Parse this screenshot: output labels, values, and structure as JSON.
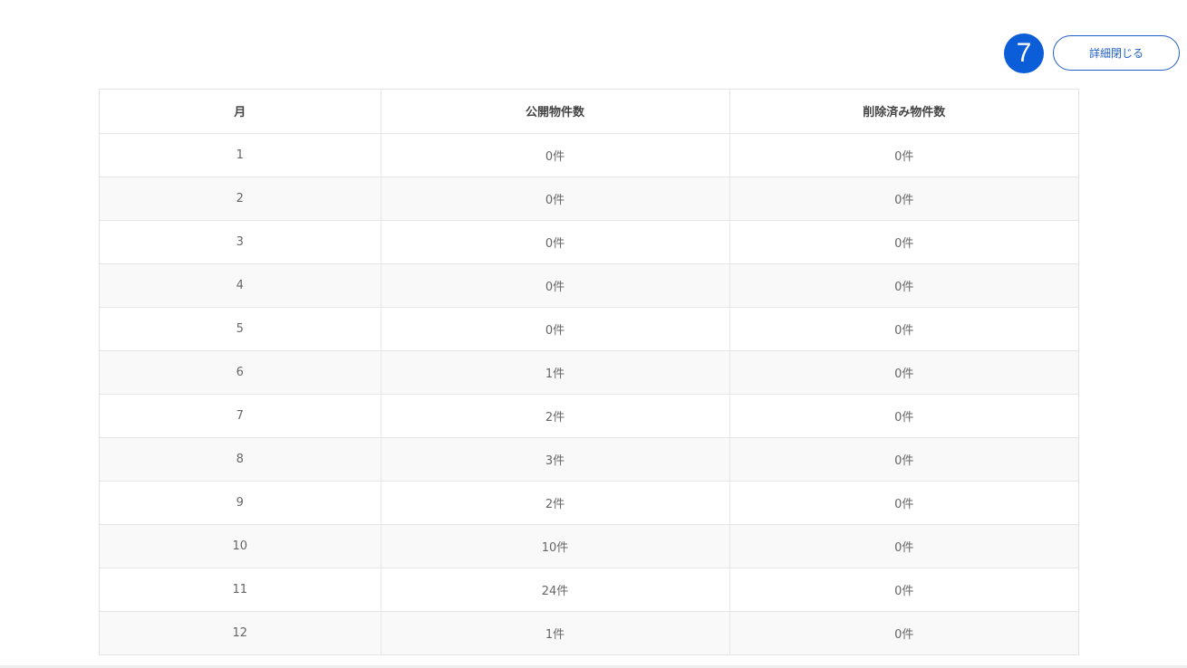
{
  "step_badge": "7",
  "toggle_button_label": "詳細閉じる",
  "table": {
    "headers": [
      "月",
      "公開物件数",
      "削除済み物件数"
    ],
    "rows": [
      [
        "1",
        "0件",
        "0件"
      ],
      [
        "2",
        "0件",
        "0件"
      ],
      [
        "3",
        "0件",
        "0件"
      ],
      [
        "4",
        "0件",
        "0件"
      ],
      [
        "5",
        "0件",
        "0件"
      ],
      [
        "6",
        "1件",
        "0件"
      ],
      [
        "7",
        "2件",
        "0件"
      ],
      [
        "8",
        "3件",
        "0件"
      ],
      [
        "9",
        "2件",
        "0件"
      ],
      [
        "10",
        "10件",
        "0件"
      ],
      [
        "11",
        "24件",
        "0件"
      ],
      [
        "12",
        "1件",
        "0件"
      ]
    ]
  },
  "colors": {
    "accent": "#0b5ed7",
    "button_border": "#1f5fc7",
    "row_alt": "#f9f9f9",
    "border": "#e6e6e6"
  }
}
